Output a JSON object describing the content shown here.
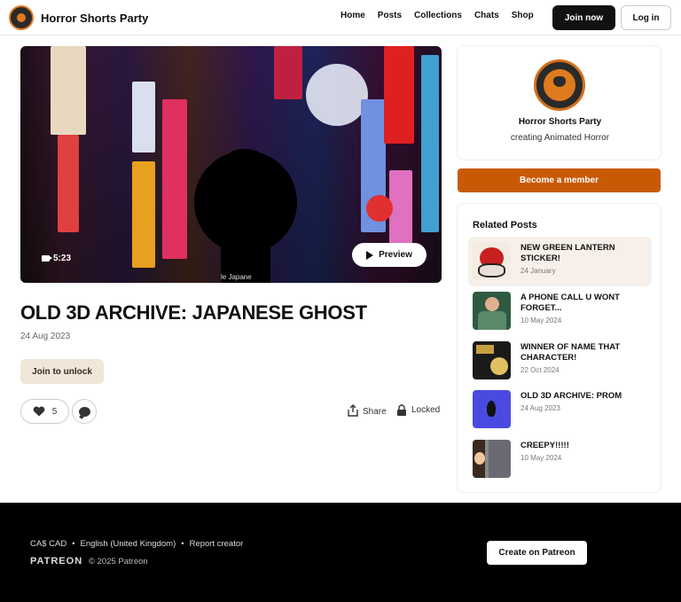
{
  "header": {
    "brand_name": "Horror Shorts Party",
    "nav": [
      "Home",
      "Posts",
      "Collections",
      "Chats",
      "Shop"
    ],
    "join_label": "Join now",
    "login_label": "Log in"
  },
  "post": {
    "duration": "5:23",
    "preview_label": "Preview",
    "watermark": "le Japane",
    "title": "OLD 3D ARCHIVE: JAPANESE GHOST",
    "date": "24 Aug 2023",
    "unlock_label": "Join to unlock",
    "likes": "5",
    "share_label": "Share",
    "locked_label": "Locked"
  },
  "creator": {
    "name": "Horror Shorts Party",
    "tagline": "creating Animated Horror",
    "member_label": "Become a member"
  },
  "related": {
    "title": "Related Posts",
    "items": [
      {
        "name": "NEW GREEN LANTERN STICKER!",
        "date": "24 January"
      },
      {
        "name": "A PHONE CALL U WONT FORGET...",
        "date": "10 May 2024"
      },
      {
        "name": "WINNER OF NAME THAT CHARACTER!",
        "date": "22 Oct 2024"
      },
      {
        "name": "OLD 3D ARCHIVE: PROM",
        "date": "24 Aug 2023"
      },
      {
        "name": "CREEPY!!!!!",
        "date": "10 May 2024"
      }
    ]
  },
  "footer": {
    "currency": "CA$ CAD",
    "language": "English (United Kingdom)",
    "report": "Report creator",
    "logo": "PATREON",
    "copyright": "© 2025 Patreon",
    "create_label": "Create on Patreon"
  },
  "colors": {
    "accent": "#c85a06",
    "brand_orange": "#e07a1f"
  }
}
